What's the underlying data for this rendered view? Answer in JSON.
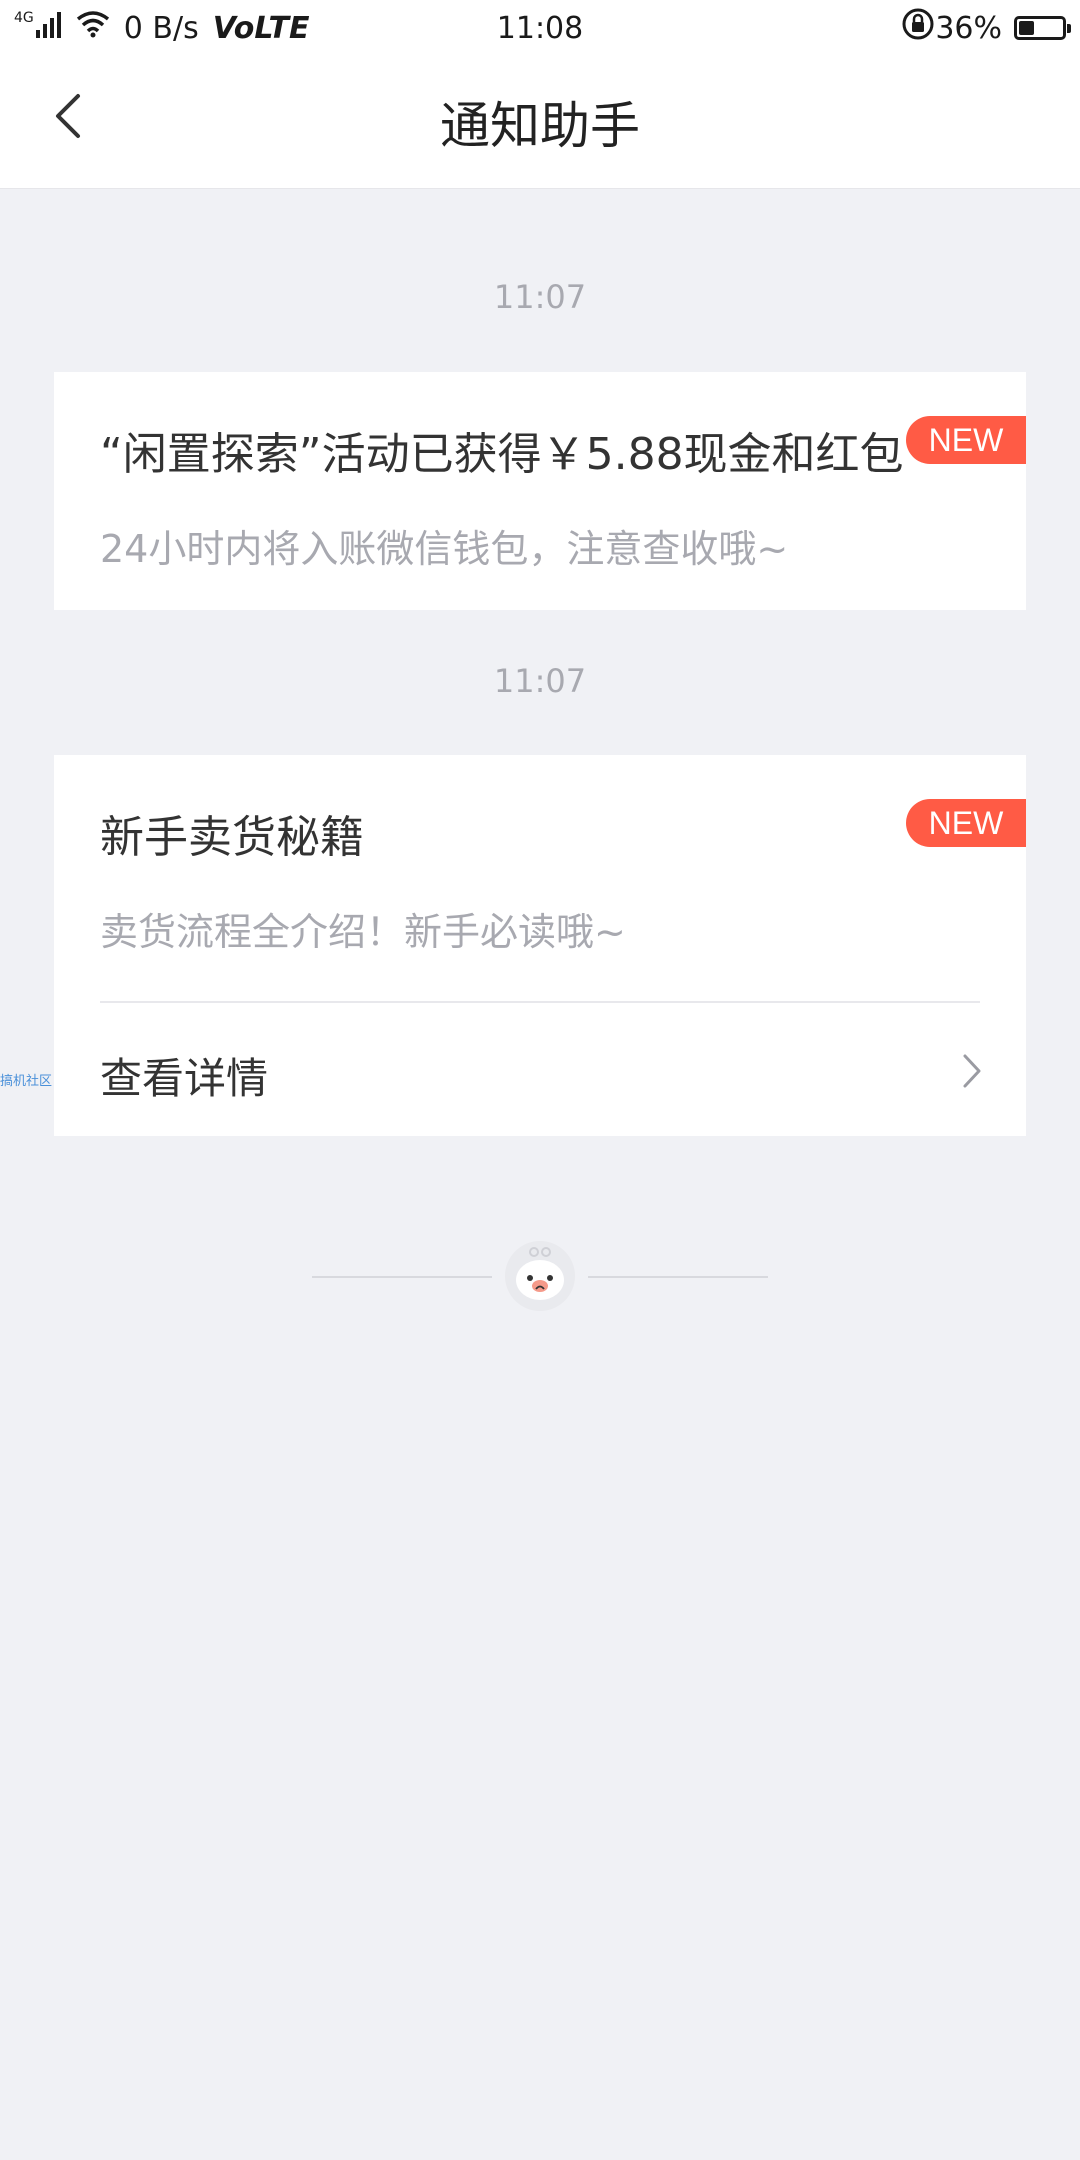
{
  "status_bar": {
    "network_type": "4G",
    "speed": "0 B/s",
    "volte": "VoLTE",
    "time": "11:08",
    "battery_percent": "36%",
    "battery_level": 0.36
  },
  "header": {
    "title": "通知助手",
    "back_icon": "chevron-left-icon"
  },
  "messages": [
    {
      "timestamp": "11:07",
      "title": "“闲置探索”活动已获得￥5.88现金和红包",
      "subtitle": "24小时内将入账微信钱包，注意查收哦~",
      "badge": "NEW"
    },
    {
      "timestamp": "11:07",
      "title": "新手卖货秘籍",
      "subtitle": "卖货流程全介绍！新手必读哦~",
      "badge": "NEW",
      "detail_label": "查看详情",
      "detail_icon": "chevron-right-icon"
    }
  ],
  "side_watermark": "搞机社区",
  "footer": {
    "mascot_icon": "sad-mascot-icon"
  },
  "colors": {
    "background": "#f0f1f5",
    "badge": "#ff5b45",
    "muted_text": "#a8a9b0"
  }
}
